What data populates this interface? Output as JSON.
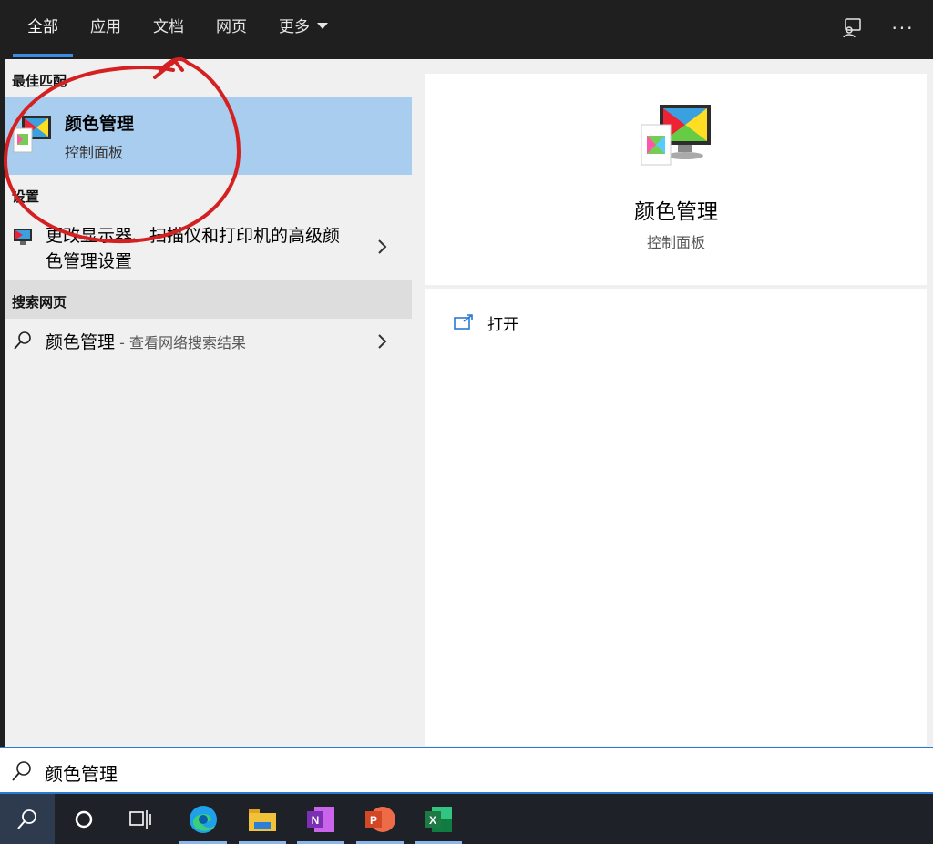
{
  "tabs": [
    {
      "label": "全部",
      "active": true
    },
    {
      "label": "应用",
      "active": false
    },
    {
      "label": "文档",
      "active": false
    },
    {
      "label": "网页",
      "active": false
    },
    {
      "label": "更多",
      "active": false
    }
  ],
  "top_icons": [
    "feedback-icon",
    "more-options-icon"
  ],
  "top_more_glyph": "···",
  "best_match": {
    "section_title": "最佳匹配",
    "name": "颜色管理",
    "subtitle": "控制面板",
    "icon": "color-management-icon"
  },
  "settings": {
    "section_title": "设置",
    "item_text": "更改显示器、扫描仪和打印机的高级颜色管理设置",
    "icon": "monitor-settings-icon"
  },
  "web_search": {
    "section_title": "搜索网页",
    "query": "颜色管理",
    "suffix": " - 查看网络搜索结果",
    "icon": "search-icon"
  },
  "detail": {
    "name": "颜色管理",
    "subtitle": "控制面板",
    "icon": "color-management-icon",
    "actions": [
      {
        "label": "打开",
        "icon": "open-external-icon"
      }
    ]
  },
  "search_box": {
    "value": "颜色管理",
    "icon": "search-icon"
  },
  "taskbar": {
    "buttons": [
      "search-icon",
      "cortana-circle-icon",
      "task-view-icon"
    ],
    "apps": [
      {
        "name": "edge-icon",
        "color": "#1fa0e8"
      },
      {
        "name": "file-explorer-icon",
        "color": "#f2c13a"
      },
      {
        "name": "onenote-icon",
        "color": "#7d2fb3",
        "letter": "N"
      },
      {
        "name": "powerpoint-icon",
        "color": "#d24726",
        "letter": "P"
      },
      {
        "name": "excel-icon",
        "color": "#1d7a43",
        "letter": "X"
      }
    ]
  },
  "colors": {
    "accent": "#2b79d0",
    "selection": "#a9cdee",
    "annotation": "#d42020"
  }
}
